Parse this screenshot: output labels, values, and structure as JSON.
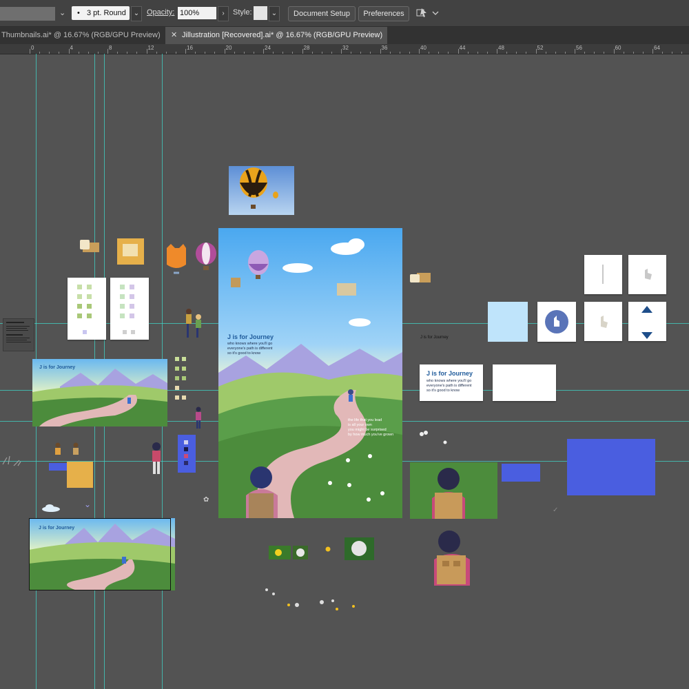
{
  "control_bar": {
    "stroke_profile": "3 pt. Round",
    "opacity_label": "Opacity:",
    "opacity_value": "100%",
    "style_label": "Style:",
    "document_setup": "Document Setup",
    "preferences": "Preferences"
  },
  "tabs": [
    {
      "label": "Thumbnails.ai* @ 16.67% (RGB/GPU Preview)",
      "active": false
    },
    {
      "label": "Jillustration [Recovered].ai* @ 16.67% (RGB/GPU Preview)",
      "active": true
    }
  ],
  "ruler": {
    "ticks": [
      "0",
      "4",
      "8",
      "12",
      "16",
      "20",
      "24",
      "28",
      "32",
      "36",
      "40",
      "44",
      "48",
      "52",
      "56",
      "60",
      "64"
    ]
  },
  "artwork": {
    "main_title": "J is for Journey",
    "main_body": [
      "who knows where you'll go",
      "everyone's path is different",
      "so it's good to know"
    ],
    "main_quote": [
      "the life that you lead",
      "is all your own",
      "you might be surprised",
      "by how much you've grown"
    ],
    "side_label": "J is for Journey",
    "card_title": "J is for Journey",
    "card_body": [
      "who knows where you'll go",
      "everyone's path is different",
      "so it's good to know"
    ],
    "thumb1_title": "J is for Journey",
    "thumb2_title": "J is for Journey"
  },
  "colors": {
    "guide": "#3fd6c8",
    "canvas": "#535353",
    "accent_blue": "#4a5ee0",
    "title_blue": "#1e5a9a"
  }
}
